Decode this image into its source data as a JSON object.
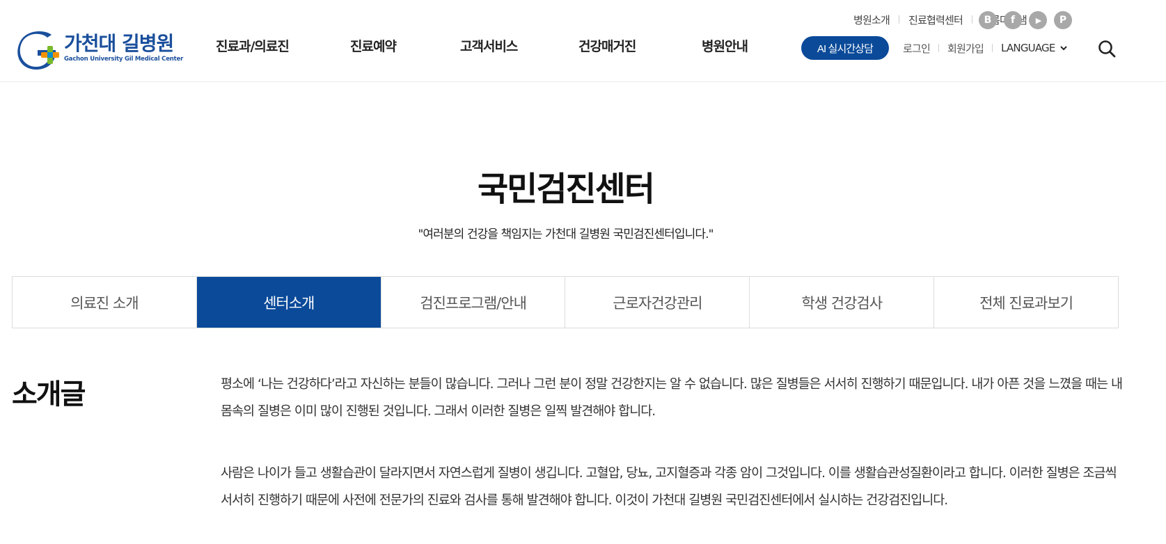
{
  "header": {
    "logo": {
      "name": "가천대 길병원",
      "sub": "Gachon University Gil Medical Center"
    },
    "gnb": [
      "진료과/의료진",
      "진료예약",
      "고객서비스",
      "건강매거진",
      "병원안내"
    ],
    "util_top": [
      "병원소개",
      "진료협력센터",
      "아름다운샘"
    ],
    "sns": [
      {
        "name": "blog-icon",
        "glyph": "B"
      },
      {
        "name": "facebook-icon",
        "glyph": "f"
      },
      {
        "name": "youtube-icon",
        "glyph": "▶"
      },
      {
        "name": "post-icon",
        "glyph": "P"
      }
    ],
    "ai_button": "AI 실시간상담",
    "login": "로그인",
    "signup": "회원가입",
    "language": "LANGUAGE"
  },
  "page": {
    "title": "국민검진센터",
    "subtitle": "\"여러분의 건강을 책임지는 가천대 길병원 국민검진센터입니다.\""
  },
  "tabs": [
    {
      "label": "의료진 소개",
      "active": false
    },
    {
      "label": "센터소개",
      "active": true
    },
    {
      "label": "검진프로그램/안내",
      "active": false
    },
    {
      "label": "근로자건강관리",
      "active": false
    },
    {
      "label": "학생 건강검사",
      "active": false
    },
    {
      "label": "전체 진료과보기",
      "active": false
    }
  ],
  "content": {
    "section_title": "소개글",
    "paragraphs": [
      "평소에 ‘나는 건강하다’라고 자신하는 분들이 많습니다. 그러나 그런 분이 정말 건강한지는 알 수 없습니다. 많은 질병들은 서서히 진행하기 때문입니다. 내가 아픈 것을 느꼈을 때는 내 몸속의 질병은 이미 많이 진행된 것입니다. 그래서 이러한 질병은 일찍 발견해야 합니다.",
      "사람은 나이가 들고 생활습관이 달라지면서 자연스럽게 질병이 생깁니다. 고혈압, 당뇨, 고지혈증과 각종 암이 그것입니다. 이를 생활습관성질환이라고 합니다. 이러한 질병은 조금씩 서서히 진행하기 때문에 사전에 전문가의 진료와 검사를 통해 발견해야 합니다. 이것이 가천대 길병원 국민검진센터에서 실시하는 건강검진입니다."
    ]
  },
  "colors": {
    "primary": "#0a4a99",
    "logo_green": "#7ab929",
    "logo_orange": "#f39200"
  }
}
